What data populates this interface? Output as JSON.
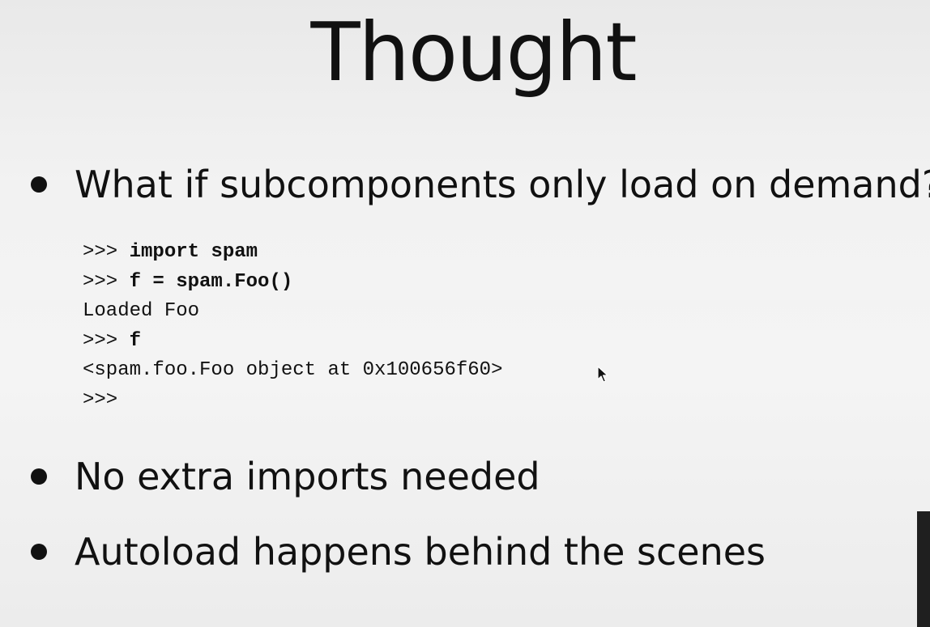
{
  "slide": {
    "title": "Thought",
    "bullets": [
      "What if subcomponents only load on demand?",
      "No extra imports needed",
      "Autoload happens behind the scenes"
    ],
    "code": {
      "line1_prompt": ">>> ",
      "line1_code": "import spam",
      "line2_prompt": ">>> ",
      "line2_code": "f = spam.Foo()",
      "line3_output": "Loaded Foo",
      "line4_prompt": ">>> ",
      "line4_code": "f",
      "line5_output": "<spam.foo.Foo object at 0x100656f60>",
      "line6_prompt": ">>>"
    }
  },
  "icons": {
    "cursor": "mouse-pointer-icon",
    "bullet": "bullet-dot-icon"
  },
  "colors": {
    "text": "#111111",
    "background": "#f2f2f2"
  }
}
